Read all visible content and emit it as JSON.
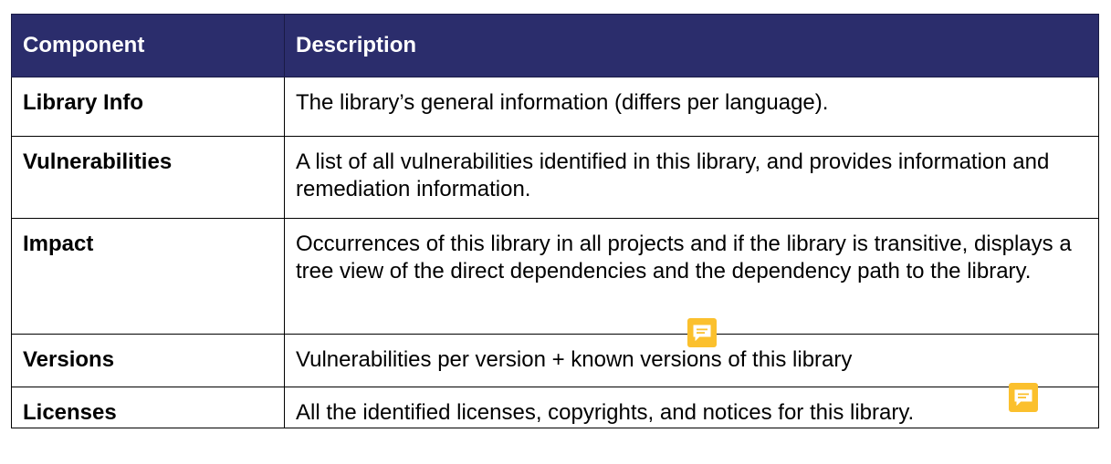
{
  "table": {
    "headers": [
      "Component",
      "Description"
    ],
    "rows": [
      {
        "component": "Library Info",
        "description": "The library’s general information (differs per language)."
      },
      {
        "component": "Vulnerabilities",
        "description": "A list of all vulnerabilities identified in this library, and provides information and remediation information."
      },
      {
        "component": "Impact",
        "description": "Occurrences of this library in all projects and if the library is transitive, displays a tree view of the direct dependencies and the dependency path to the library."
      },
      {
        "component": "Versions",
        "description": "Vulnerabilities per version + known versions of this library"
      },
      {
        "component": "Licenses",
        "description": "All the identified licenses, copyrights, and notices for this library."
      }
    ]
  },
  "colors": {
    "header_bg": "#2b2d6c",
    "header_text": "#ffffff",
    "comment_icon": "#fbc02d"
  },
  "icons": {
    "comment": "comment-icon"
  }
}
